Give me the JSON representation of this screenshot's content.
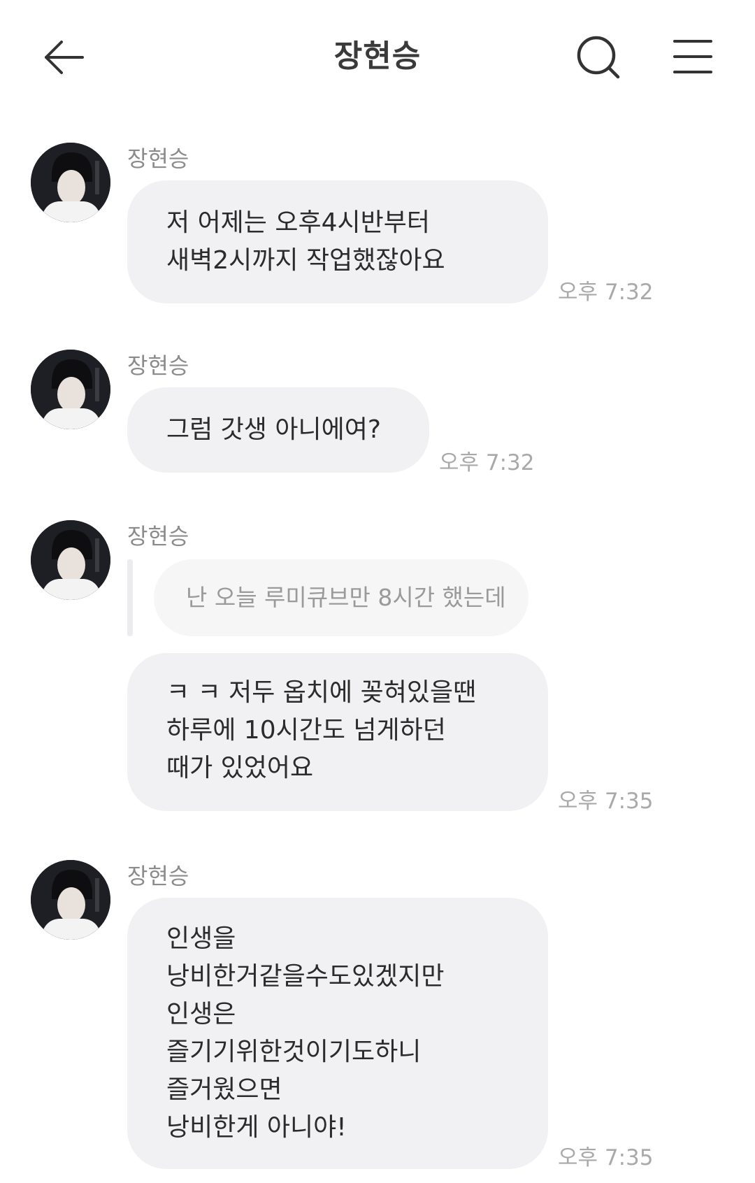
{
  "header": {
    "title": "장현승",
    "back_icon": "arrow-left-icon",
    "search_icon": "search-icon",
    "menu_icon": "hamburger-menu-icon"
  },
  "colors": {
    "bubble": "#f1f1f3",
    "reply_bubble": "#f6f6f7",
    "timestamp": "#a9a9a9",
    "sender_name": "#8b8b8b"
  },
  "messages": [
    {
      "sender": "장현승",
      "lines": [
        "저 어제는 오후4시반부터",
        "새벽2시까지 작업했잖아요"
      ],
      "time": "오후 7:32"
    },
    {
      "sender": "장현승",
      "lines": [
        "그럼 갓생 아니에여?"
      ],
      "time": "오후 7:32"
    },
    {
      "sender": "장현승",
      "reply_to": "난 오늘 루미큐브만 8시간 했는데",
      "lines": [
        "ㅋ ㅋ 저두 옵치에 꽂혀있을땐",
        "하루에 10시간도 넘게하던",
        "때가 있었어요"
      ],
      "time": "오후 7:35"
    },
    {
      "sender": "장현승",
      "lines": [
        "인생을",
        "낭비한거같을수도있겠지만",
        "인생은",
        "즐기기위한것이기도하니",
        "즐거웠으면",
        "낭비한게 아니야!"
      ],
      "time": "오후 7:35"
    }
  ]
}
